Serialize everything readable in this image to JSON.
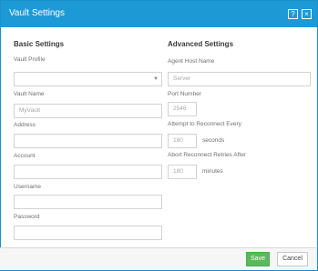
{
  "window": {
    "title": "Vault Settings",
    "help_label": "?",
    "close_label": "×"
  },
  "basic": {
    "heading": "Basic Settings",
    "vault_profile": {
      "label": "Vault Profile",
      "value": ""
    },
    "vault_name": {
      "label": "Vault Name",
      "placeholder": "MyVault"
    },
    "address": {
      "label": "Address",
      "value": ""
    },
    "account": {
      "label": "Account",
      "value": ""
    },
    "username": {
      "label": "Username",
      "value": ""
    },
    "password": {
      "label": "Password",
      "value": ""
    }
  },
  "advanced": {
    "heading": "Advanced Settings",
    "agent_host": {
      "label": "Agent Host Name",
      "placeholder": "Server"
    },
    "port": {
      "label": "Port Number",
      "placeholder": "2546"
    },
    "reconnect_every": {
      "label": "Attempt to Reconnect Every",
      "placeholder": "180",
      "unit": "seconds"
    },
    "abort_after": {
      "label": "Abort Reconnect Retries After",
      "placeholder": "180",
      "unit": "minutes"
    }
  },
  "footer": {
    "save_label": "Save",
    "cancel_label": "Cancel"
  },
  "colors": {
    "titlebar": "#1d9ad6",
    "save": "#5cb85c"
  }
}
